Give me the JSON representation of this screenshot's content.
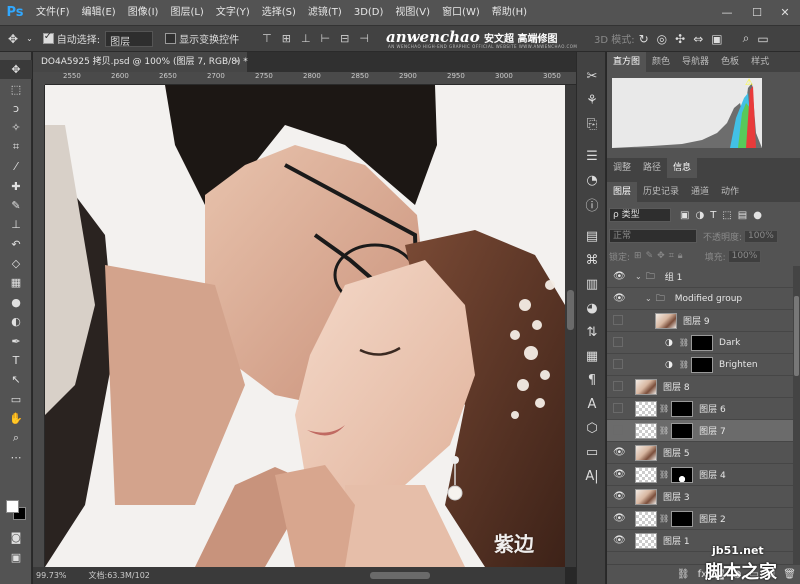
{
  "app": {
    "logo": "Ps"
  },
  "menu": [
    "文件(F)",
    "编辑(E)",
    "图像(I)",
    "图层(L)",
    "文字(Y)",
    "选择(S)",
    "滤镜(T)",
    "3D(D)",
    "视图(V)",
    "窗口(W)",
    "帮助(H)"
  ],
  "window_controls": {
    "minimize": "—",
    "maximize": "☐",
    "close": "✕"
  },
  "options": {
    "auto_select_label": "自动选择:",
    "auto_select_value": "图层",
    "show_transform_label": "显示变换控件",
    "mode_3d_label": "3D 模式:"
  },
  "brand": {
    "main": "anwenchao",
    "cn": "安文超 高端修图",
    "sub": "AN WENCHAO HIGH-END GRAPHIC OFFICIAL WEBSITE WWW.ANWENCHAO.COM"
  },
  "document": {
    "tab_title": "DO4A5925 拷贝.psd @ 100% (图层 7, RGB/8) *",
    "close_glyph": "×",
    "ruler_ticks": [
      "2550",
      "2600",
      "2650",
      "2700",
      "2750",
      "2800",
      "2850",
      "2900",
      "2950",
      "3000",
      "3050"
    ],
    "watermark": "紫边"
  },
  "status": {
    "zoom": "99.73%",
    "doc_info": "文档:63.3M/1020.0M"
  },
  "top_panel": {
    "tabs": [
      "直方图",
      "颜色",
      "导航器",
      "色板",
      "样式"
    ],
    "active": "直方图",
    "warning_glyph": "⚠"
  },
  "mid_panel": {
    "tabs": [
      "调整",
      "路径",
      "信息"
    ],
    "active": "信息"
  },
  "layers_panel": {
    "tabs": [
      "图层",
      "历史记录",
      "通道",
      "动作"
    ],
    "active": "图层",
    "filter_type": "ρ 类型",
    "blend_mode": "正常",
    "opacity_label": "不透明度:",
    "opacity_value": "100%",
    "lock_label": "锁定:",
    "fill_label": "填充:",
    "fill_value": "100%",
    "layers": [
      {
        "name": "组 1",
        "kind": "group",
        "visible": true,
        "indent": 0
      },
      {
        "name": "Modified group",
        "kind": "group",
        "visible": true,
        "indent": 1
      },
      {
        "name": "图层 9",
        "kind": "photo",
        "visible": false,
        "indent": 2
      },
      {
        "name": "Dark",
        "kind": "adjust",
        "visible": false,
        "indent": 2
      },
      {
        "name": "Brighten",
        "kind": "adjust",
        "visible": false,
        "indent": 2
      },
      {
        "name": "图层 8",
        "kind": "photo",
        "visible": false,
        "indent": 0
      },
      {
        "name": "图层 6",
        "kind": "masked",
        "visible": false,
        "indent": 0
      },
      {
        "name": "图层 7",
        "kind": "masked",
        "visible": false,
        "indent": 0,
        "selected": true
      },
      {
        "name": "图层 5",
        "kind": "photo",
        "visible": true,
        "indent": 0
      },
      {
        "name": "图层 4",
        "kind": "masked4",
        "visible": true,
        "indent": 0
      },
      {
        "name": "图层 3",
        "kind": "photo",
        "visible": true,
        "indent": 0
      },
      {
        "name": "图层 2",
        "kind": "masked",
        "visible": true,
        "indent": 0
      },
      {
        "name": "图层 1",
        "kind": "check",
        "visible": true,
        "indent": 0
      }
    ]
  },
  "site_watermark": {
    "line1": "jb51.net",
    "line2": "脚本之家"
  }
}
